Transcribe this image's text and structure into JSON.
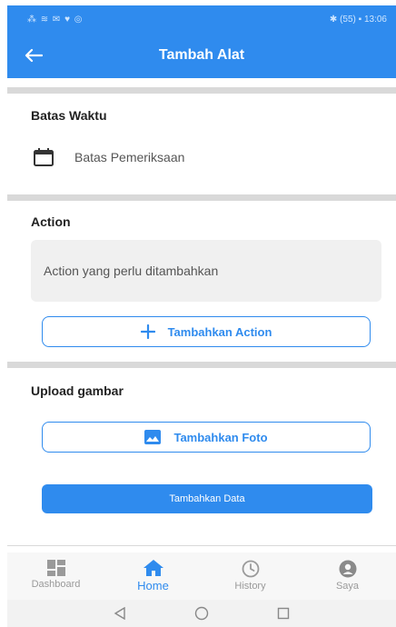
{
  "status_bar": {
    "left_text": "⁂ ≋ ✉ ♥ ◎",
    "right_text": "✱ (55) ▪ 13:06"
  },
  "app_bar": {
    "title": "Tambah Alat",
    "back_icon": "arrow-left-icon"
  },
  "deadline": {
    "title": "Batas Waktu",
    "field_label": "Batas Pemeriksaan",
    "icon": "calendar-icon"
  },
  "action": {
    "title": "Action",
    "placeholder": "Action yang perlu ditambahkan",
    "add_button": "Tambahkan Action",
    "add_icon": "plus-icon"
  },
  "upload": {
    "title": "Upload gambar",
    "photo_button": "Tambahkan Foto",
    "photo_icon": "image-icon"
  },
  "submit": {
    "label": "Tambahkan Data"
  },
  "bottom_nav": {
    "items": [
      {
        "label": "Dashboard",
        "icon": "dashboard-icon",
        "active": false
      },
      {
        "label": "Home",
        "icon": "home-icon",
        "active": true
      },
      {
        "label": "History",
        "icon": "clock-icon",
        "active": false
      },
      {
        "label": "Saya",
        "icon": "user-icon",
        "active": false
      }
    ]
  },
  "colors": {
    "primary": "#2f8bee",
    "divider": "#d9d9d9",
    "muted": "#9a9a9a",
    "field_bg": "#f0f0f0"
  }
}
